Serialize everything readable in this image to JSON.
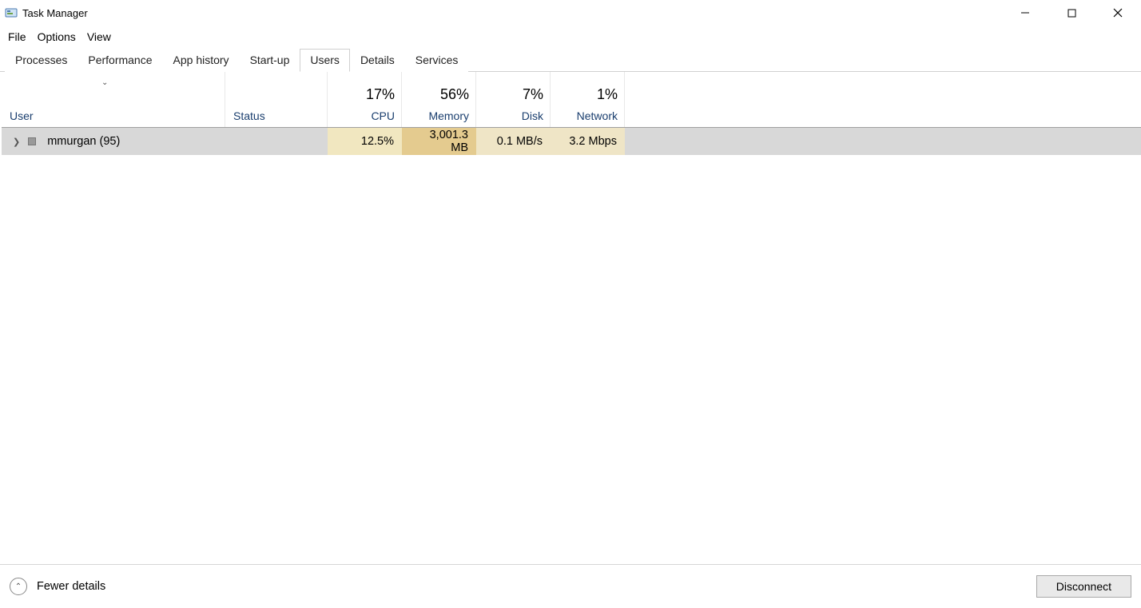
{
  "window": {
    "title": "Task Manager"
  },
  "menu": {
    "file": "File",
    "options": "Options",
    "view": "View"
  },
  "tabs": {
    "processes": "Processes",
    "performance": "Performance",
    "app_history": "App history",
    "startup": "Start-up",
    "users": "Users",
    "details": "Details",
    "services": "Services"
  },
  "columns": {
    "user": "User",
    "status": "Status",
    "cpu_pct": "17%",
    "cpu_label": "CPU",
    "mem_pct": "56%",
    "mem_label": "Memory",
    "disk_pct": "7%",
    "disk_label": "Disk",
    "net_pct": "1%",
    "net_label": "Network"
  },
  "rows": [
    {
      "user": "mmurgan (95)",
      "status": "",
      "cpu": "12.5%",
      "memory": "3,001.3 MB",
      "disk": "0.1 MB/s",
      "network": "3.2 Mbps"
    }
  ],
  "footer": {
    "fewer_details": "Fewer details",
    "disconnect": "Disconnect"
  }
}
